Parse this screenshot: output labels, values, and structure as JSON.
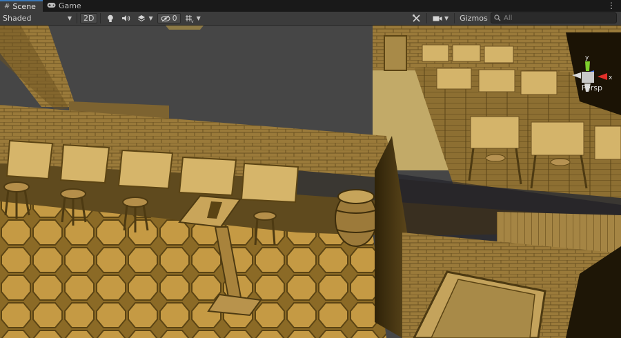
{
  "tabs": [
    {
      "label": "Scene",
      "icon": "hashtag-icon",
      "active": true
    },
    {
      "label": "Game",
      "icon": "gamepad-icon",
      "active": false
    }
  ],
  "toolbar": {
    "shading_mode": "Shaded",
    "toggle_2d": "2D",
    "hidden_objects_count": "0",
    "gizmos_label": "Gizmos",
    "search_placeholder": "All"
  },
  "viewport": {
    "orientation_label": "Persp",
    "axis_labels": {
      "x": "x",
      "y": "y"
    },
    "colors": {
      "x_axis": "#e0302a",
      "y_axis": "#7ecf2c",
      "z_axis": "#3d6be0",
      "sky": "#464646"
    }
  }
}
